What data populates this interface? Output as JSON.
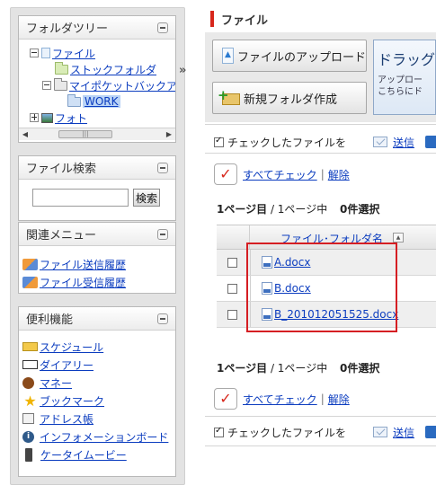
{
  "sidebar": {
    "tree_panel": {
      "title": "フォルダツリー",
      "items": [
        {
          "label": "ファイル"
        },
        {
          "label": "ストックフォルダ"
        },
        {
          "label": "マイポケットバックアップ"
        },
        {
          "label": "WORK"
        },
        {
          "label": "フォト"
        }
      ],
      "scroll_thumb": "|||"
    },
    "search_panel": {
      "title": "ファイル検索",
      "input_value": "",
      "button_label": "検索"
    },
    "related_panel": {
      "title": "関連メニュー",
      "items": [
        {
          "label": "ファイル送信履歴",
          "icon": "send-history-icon"
        },
        {
          "label": "ファイル受信履歴",
          "icon": "receive-history-icon"
        }
      ]
    },
    "utility_panel": {
      "title": "便利機能",
      "items": [
        {
          "label": "スケジュール",
          "icon": "schedule-icon"
        },
        {
          "label": "ダイアリー",
          "icon": "diary-icon"
        },
        {
          "label": "マネー",
          "icon": "money-icon"
        },
        {
          "label": "ブックマーク",
          "icon": "star-icon"
        },
        {
          "label": "アドレス帳",
          "icon": "address-book-icon"
        },
        {
          "label": "インフォメーションボード",
          "icon": "info-icon"
        },
        {
          "label": "ケータイムービー",
          "icon": "mobile-phone-icon"
        }
      ]
    },
    "collapse_glyph": "»"
  },
  "main": {
    "title": "ファイル",
    "upload_button": "ファイルのアップロード",
    "new_folder_button": "新規フォルダ作成",
    "drag_title": "ドラッグ",
    "drag_sub_1": "アップロー",
    "drag_sub_2": "こちらにド",
    "checked_files_label": "チェックしたファイルを",
    "send_label": "送信",
    "check_all": "すべてチェック",
    "release": "解除",
    "separator": "|",
    "page_label": "1ページ目",
    "page_sep": " / ",
    "page_total": "1ページ中",
    "selected_count": "0件選択",
    "column_header": "ファイル･フォルダ名",
    "sort_glyph": "▲",
    "files": [
      {
        "name": "A.docx"
      },
      {
        "name": "B.docx"
      },
      {
        "name": "B_201012051525.docx"
      }
    ]
  },
  "colors": {
    "accent_red": "#d7261b",
    "link_blue": "#0b3cbf",
    "highlight_box": "#d51e23"
  }
}
